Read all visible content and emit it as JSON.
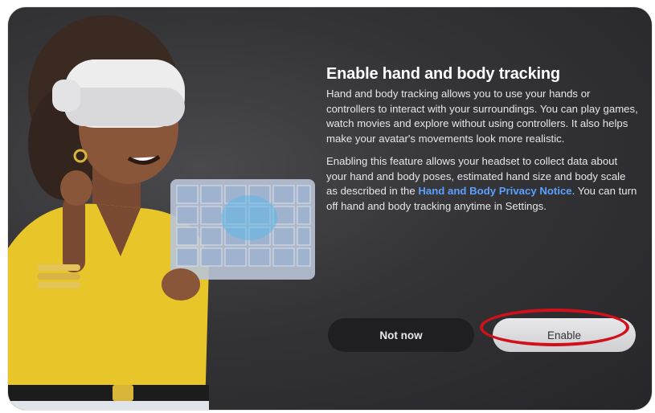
{
  "dialog": {
    "title": "Enable hand and body tracking",
    "paragraph1": "Hand and body tracking allows you to use your hands or controllers to interact with your surroundings. You can play games, watch movies and explore without using controllers. It also helps make your avatar's movements look more realistic.",
    "paragraph2_before_link": "Enabling this feature allows your headset to collect data about your hand and body poses, estimated hand size and body scale as described in the ",
    "paragraph2_link": "Hand and Body Privacy Notice",
    "paragraph2_after_link": ". You can turn off hand and body tracking anytime in Settings."
  },
  "buttons": {
    "not_now": "Not now",
    "enable": "Enable"
  },
  "colors": {
    "background": "#343437",
    "link": "#5aa0ff",
    "highlight": "#d0101a",
    "shirt": "#e8c62a"
  },
  "illustration": {
    "name": "avatar-with-vr-headset-illustration"
  }
}
